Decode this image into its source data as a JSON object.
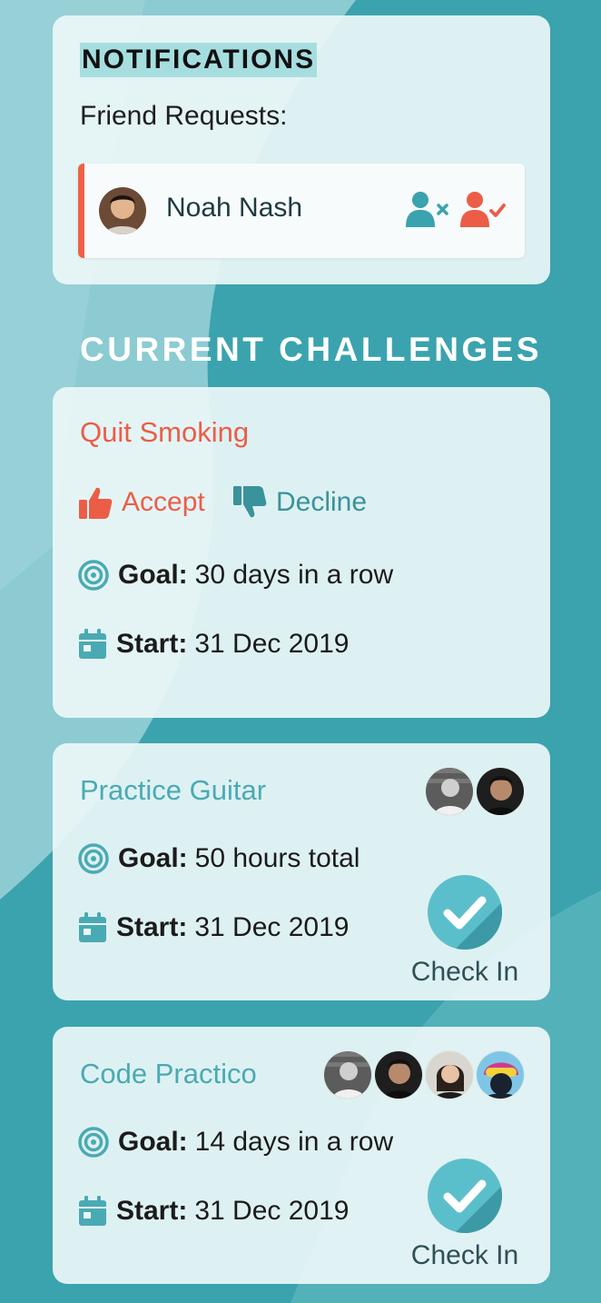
{
  "notifications": {
    "title": "NOTIFICATIONS",
    "friend_requests_label": "Friend Requests:",
    "requests": [
      {
        "name": "Noah Nash",
        "decline_icon": "user-x-icon",
        "accept_icon": "user-check-icon"
      }
    ]
  },
  "section_title": "CURRENT CHALLENGES",
  "challenges": [
    {
      "title": "Quit Smoking",
      "accept_label": "Accept",
      "decline_label": "Decline",
      "goal_label": "Goal:",
      "goal_value": "30 days in a row",
      "start_label": "Start:",
      "start_value": "31 Dec 2019"
    },
    {
      "title": "Practice Guitar",
      "goal_label": "Goal:",
      "goal_value": "50 hours total",
      "start_label": "Start:",
      "start_value": "31 Dec 2019",
      "checkin_label": "Check In"
    },
    {
      "title": "Code Practico",
      "goal_label": "Goal:",
      "goal_value": "14 days in a row",
      "start_label": "Start:",
      "start_value": "31 Dec 2019",
      "checkin_label": "Check In"
    }
  ],
  "colors": {
    "background": "#3aa3ad",
    "accent_red": "#ec5d47",
    "accent_teal": "#4aaab4",
    "checkin_blue": "#5bbfcb"
  }
}
